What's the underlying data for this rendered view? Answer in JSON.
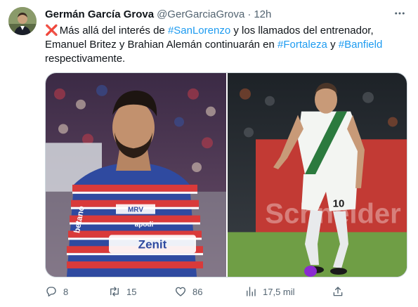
{
  "author": {
    "display_name": "Germán García Grova",
    "handle": "@GerGarciaGrova",
    "separator": "·",
    "time": "12h"
  },
  "tweet": {
    "cross_emoji": "❌",
    "line1_before": "Más allá del interés de ",
    "hashtag_sanlorenzo": "#SanLorenzo",
    "line1_after": " y los llamados del entrenador,",
    "line2_before": "Emanuel Britez y Brahian Alemán continuarán en ",
    "hashtag_fortaleza": "#Fortaleza",
    "line2_mid": " y ",
    "hashtag_banfield": "#Banfield",
    "line3": "respectivamente."
  },
  "media": {
    "left_photo": {
      "description_icon": "player-photo-fortaleza",
      "shirt_text": {
        "sponsor_1": "MRV",
        "sponsor_2": "apodi",
        "sponsor_3": "Zenit",
        "sponsor_side": "betano"
      }
    },
    "right_photo": {
      "description_icon": "player-photo-banfield",
      "shirt_number": "10",
      "ad_board": "Schneider"
    }
  },
  "actions": {
    "replies": "8",
    "retweets": "15",
    "likes": "86",
    "views": "17,5 mil"
  },
  "colors": {
    "link": "#1d9bf0",
    "muted": "#536471",
    "text": "#0f1419"
  }
}
